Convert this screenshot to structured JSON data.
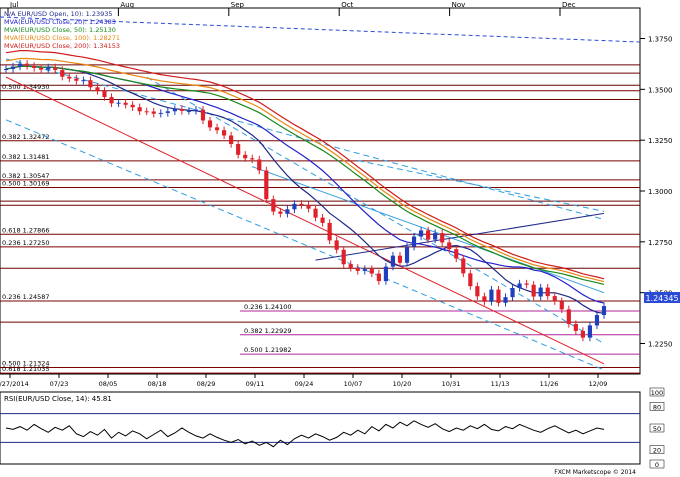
{
  "chart_data": [
    {
      "type": "candlestick",
      "title_lines": [
        "N/A EUR/USD Open, 10): 1.23935",
        "MVA(EUR/USD Close, 20): 1.24383",
        "MVA(EUR/USD Close, 50): 1.25130",
        "MVA(EUR/USD Close, 100): 1.28271",
        "MVA(EUR/USD Close, 200): 1.34153"
      ],
      "top_months": [
        "Jul",
        "Aug",
        "Sep",
        "Oct",
        "Nov",
        "Dec"
      ],
      "x_tick_labels": [
        "06/27/2014",
        "07/23",
        "08/05",
        "08/18",
        "08/29",
        "09/11",
        "09/24",
        "10/07",
        "10/20",
        "10/31",
        "11/13",
        "11/26",
        "12/09"
      ],
      "ylim": [
        1.21,
        1.39
      ],
      "y_ticks": [
        "1.3750",
        "1.3500",
        "1.3250",
        "1.3000",
        "1.2750",
        "1.2500",
        "1.2250"
      ],
      "last_price": "1.24345",
      "levels": [
        {
          "label": "0.500 1.34930",
          "value": 1.3493,
          "color": "#000000"
        },
        {
          "label": "0.382 1.32472",
          "value": 1.3247,
          "color": "#000000"
        },
        {
          "label": "0.382 1.31481",
          "value": 1.3148,
          "color": "#000000"
        },
        {
          "label": "0.382 1.30547",
          "value": 1.3055,
          "color": "#000000"
        },
        {
          "label": "0.500 1.30169",
          "value": 1.3017,
          "color": "#000000"
        },
        {
          "label": "0.618 1.27866",
          "value": 1.2787,
          "color": "#000000"
        },
        {
          "label": "0.236 1.27250",
          "value": 1.2725,
          "color": "#000000"
        },
        {
          "label": "0.236 1.24587",
          "value": 1.2459,
          "color": "#000000"
        },
        {
          "label": "0.236 1.24100",
          "value": 1.241,
          "color": "#b0279b"
        },
        {
          "label": "0.382 1.22929",
          "value": 1.2293,
          "color": "#b0279b"
        },
        {
          "label": "0.500 1.21982",
          "value": 1.2198,
          "color": "#b0279b"
        },
        {
          "label": "0.500 1.21324",
          "value": 1.2132,
          "color": "#000000"
        },
        {
          "label": "0.618 1.21035",
          "value": 1.2104,
          "color": "#000000"
        }
      ],
      "extra_levels": [
        1.362,
        1.358,
        1.352,
        1.345,
        1.295,
        1.293,
        1.262,
        1.2355
      ],
      "series": [
        {
          "name": "EUR/USD",
          "color": "#1f3fbf",
          "values": [
            1.36,
            1.3612,
            1.3626,
            1.3615,
            1.3605,
            1.3597,
            1.3608,
            1.3595,
            1.3562,
            1.3553,
            1.3542,
            1.3545,
            1.351,
            1.3492,
            1.3462,
            1.3431,
            1.3434,
            1.3424,
            1.3412,
            1.3392,
            1.3391,
            1.338,
            1.3384,
            1.3392,
            1.3403,
            1.3394,
            1.3394,
            1.34,
            1.3347,
            1.3313,
            1.3299,
            1.3273,
            1.3231,
            1.3178,
            1.3161,
            1.3155,
            1.3101,
            1.296,
            1.2899,
            1.2888,
            1.291,
            1.2937,
            1.2931,
            1.2913,
            1.2869,
            1.2843,
            1.2757,
            1.2711,
            1.264,
            1.2622,
            1.2607,
            1.2616,
            1.2594,
            1.2557,
            1.2628,
            1.2682,
            1.2647,
            1.2726,
            1.2776,
            1.2806,
            1.2761,
            1.2793,
            1.2747,
            1.2714,
            1.2668,
            1.2595,
            1.2532,
            1.2482,
            1.2455,
            1.2515,
            1.245,
            1.2478,
            1.2523,
            1.2545,
            1.2539,
            1.2481,
            1.2525,
            1.2483,
            1.2458,
            1.2418,
            1.2346,
            1.2312,
            1.2279,
            1.2339,
            1.239,
            1.2434
          ]
        }
      ],
      "moving_averages": [
        {
          "name": "MVA 10",
          "color": "#1f2a8a"
        },
        {
          "name": "MVA 20",
          "color": "#2222cc"
        },
        {
          "name": "MVA 50",
          "color": "#1a8a1a"
        },
        {
          "name": "MVA 100",
          "color": "#e8860e"
        },
        {
          "name": "MVA 200",
          "color": "#d11a1a"
        }
      ]
    },
    {
      "type": "line",
      "title": "RSI(EUR/USD Close, 14): 45.81",
      "ylim": [
        0,
        100
      ],
      "y_ticks": [
        "100",
        "80",
        "50",
        "20",
        "0"
      ],
      "levels": [
        70,
        30
      ],
      "series": [
        {
          "name": "RSI(EUR/USD Close, 14)",
          "color": "#000000",
          "values": [
            50,
            48,
            52,
            47,
            55,
            49,
            44,
            51,
            47,
            53,
            42,
            38,
            45,
            40,
            48,
            36,
            44,
            39,
            46,
            42,
            35,
            41,
            47,
            38,
            43,
            50,
            44,
            39,
            36,
            42,
            37,
            33,
            30,
            34,
            28,
            32,
            26,
            30,
            24,
            33,
            27,
            35,
            40,
            36,
            42,
            38,
            33,
            37,
            44,
            40,
            47,
            42,
            52,
            46,
            55,
            50,
            58,
            53,
            60,
            55,
            51,
            56,
            49,
            45,
            50,
            47,
            53,
            49,
            55,
            48,
            46,
            52,
            49,
            55,
            51,
            47,
            44,
            49,
            53,
            48,
            43,
            47,
            42,
            46,
            50,
            48
          ]
        }
      ]
    }
  ],
  "footer": {
    "copyright": "FXCM Marketscope © 2014"
  }
}
